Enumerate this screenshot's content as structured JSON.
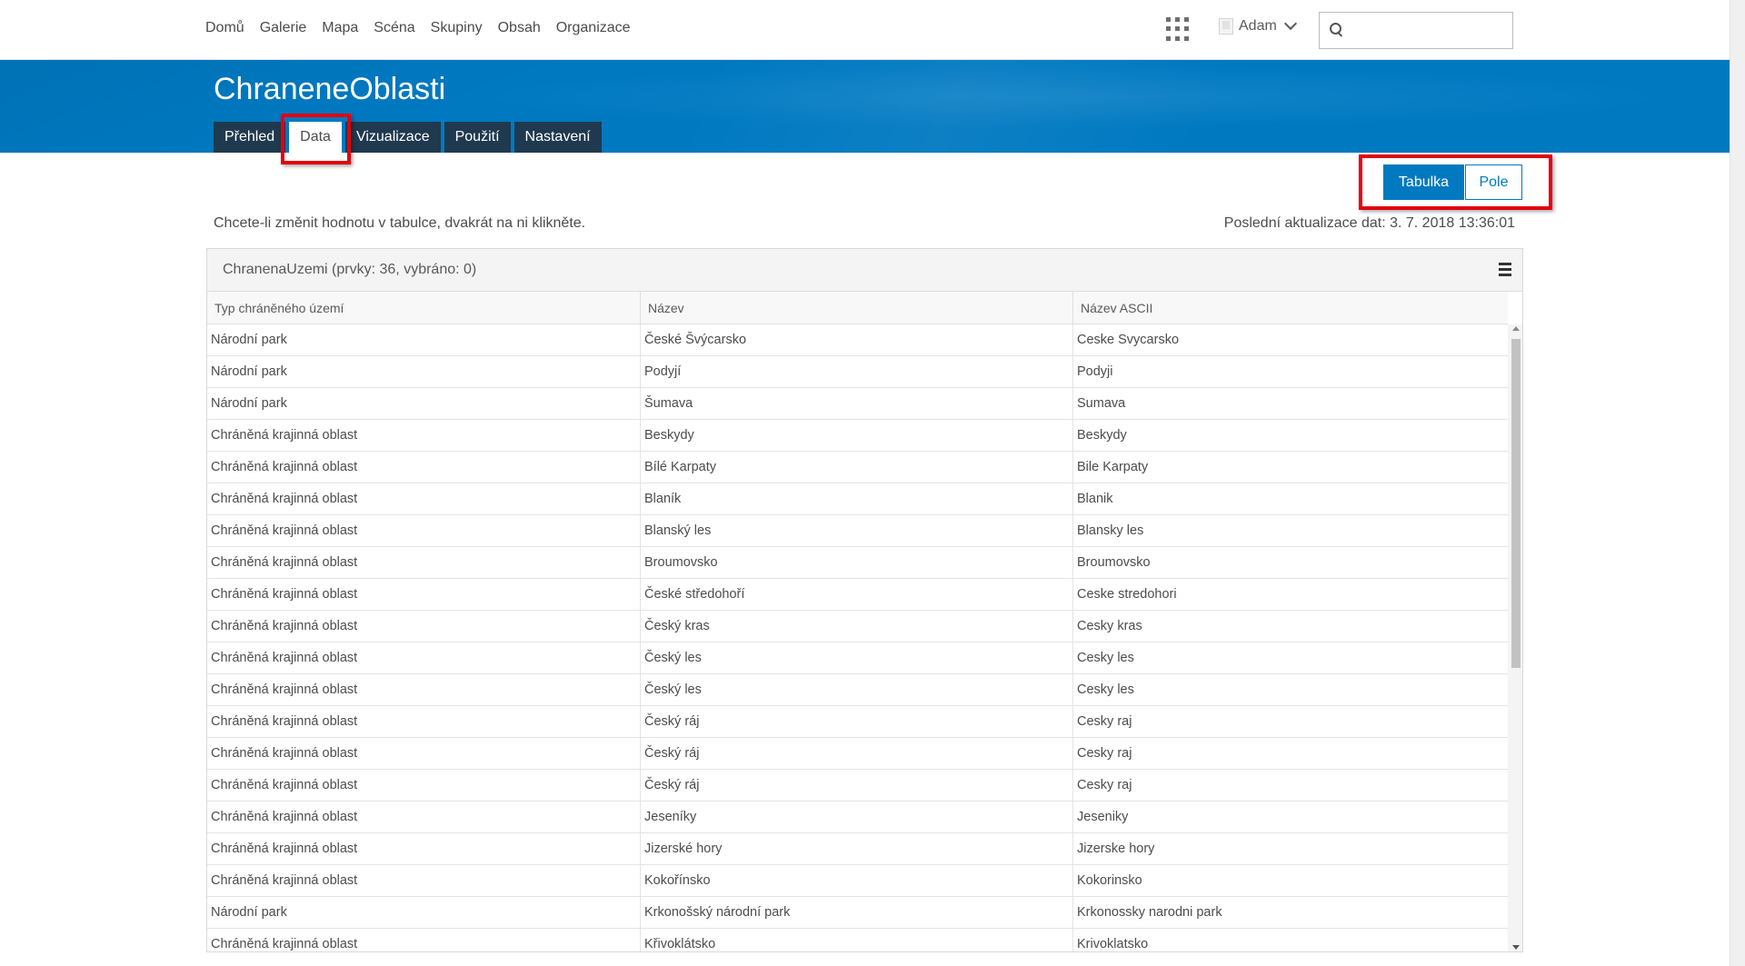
{
  "nav": {
    "links": [
      "Domů",
      "Galerie",
      "Mapa",
      "Scéna",
      "Skupiny",
      "Obsah",
      "Organizace"
    ],
    "user": "Adam",
    "search_value": ""
  },
  "banner": {
    "title": "ChraneneOblasti",
    "tabs": [
      "Přehled",
      "Data",
      "Vizualizace",
      "Použití",
      "Nastavení"
    ],
    "active_tab": "Data"
  },
  "view_toggle": {
    "table_label": "Tabulka",
    "fields_label": "Pole",
    "active": "Tabulka"
  },
  "hint": "Chcete-li změnit hodnotu v tabulce, dvakrát na ni klikněte.",
  "last_update": "Poslední aktualizace dat: 3. 7. 2018 13:36:01",
  "table": {
    "title": "ChranenaUzemi (prvky: 36, vybráno: 0)",
    "columns": [
      "Typ chráněného území",
      "Název",
      "Název ASCII"
    ],
    "rows": [
      [
        "Národní park",
        "České Švýcarsko",
        "Ceske Svycarsko"
      ],
      [
        "Národní park",
        "Podyjí",
        "Podyji"
      ],
      [
        "Národní park",
        "Šumava",
        "Sumava"
      ],
      [
        "Chráněná krajinná oblast",
        "Beskydy",
        "Beskydy"
      ],
      [
        "Chráněná krajinná oblast",
        "Bílé Karpaty",
        "Bile Karpaty"
      ],
      [
        "Chráněná krajinná oblast",
        "Blaník",
        "Blanik"
      ],
      [
        "Chráněná krajinná oblast",
        "Blanský les",
        "Blansky les"
      ],
      [
        "Chráněná krajinná oblast",
        "Broumovsko",
        "Broumovsko"
      ],
      [
        "Chráněná krajinná oblast",
        "České středohoří",
        "Ceske stredohori"
      ],
      [
        "Chráněná krajinná oblast",
        "Český kras",
        "Cesky kras"
      ],
      [
        "Chráněná krajinná oblast",
        "Český les",
        "Cesky les"
      ],
      [
        "Chráněná krajinná oblast",
        "Český les",
        "Cesky les"
      ],
      [
        "Chráněná krajinná oblast",
        "Český ráj",
        "Cesky raj"
      ],
      [
        "Chráněná krajinná oblast",
        "Český ráj",
        "Cesky raj"
      ],
      [
        "Chráněná krajinná oblast",
        "Český ráj",
        "Cesky raj"
      ],
      [
        "Chráněná krajinná oblast",
        "Jeseníky",
        "Jeseniky"
      ],
      [
        "Chráněná krajinná oblast",
        "Jizerské hory",
        "Jizerske hory"
      ],
      [
        "Chráněná krajinná oblast",
        "Kokořínsko",
        "Kokorinsko"
      ],
      [
        "Národní park",
        "Krkonošský národní park",
        "Krkonossky narodni park"
      ],
      [
        "Chráněná krajinná oblast",
        "Křivoklátsko",
        "Krivoklatsko"
      ]
    ]
  },
  "colors": {
    "banner": "#0079c1",
    "tab_bg": "#1f3a4f",
    "highlight": "#e3000f"
  }
}
